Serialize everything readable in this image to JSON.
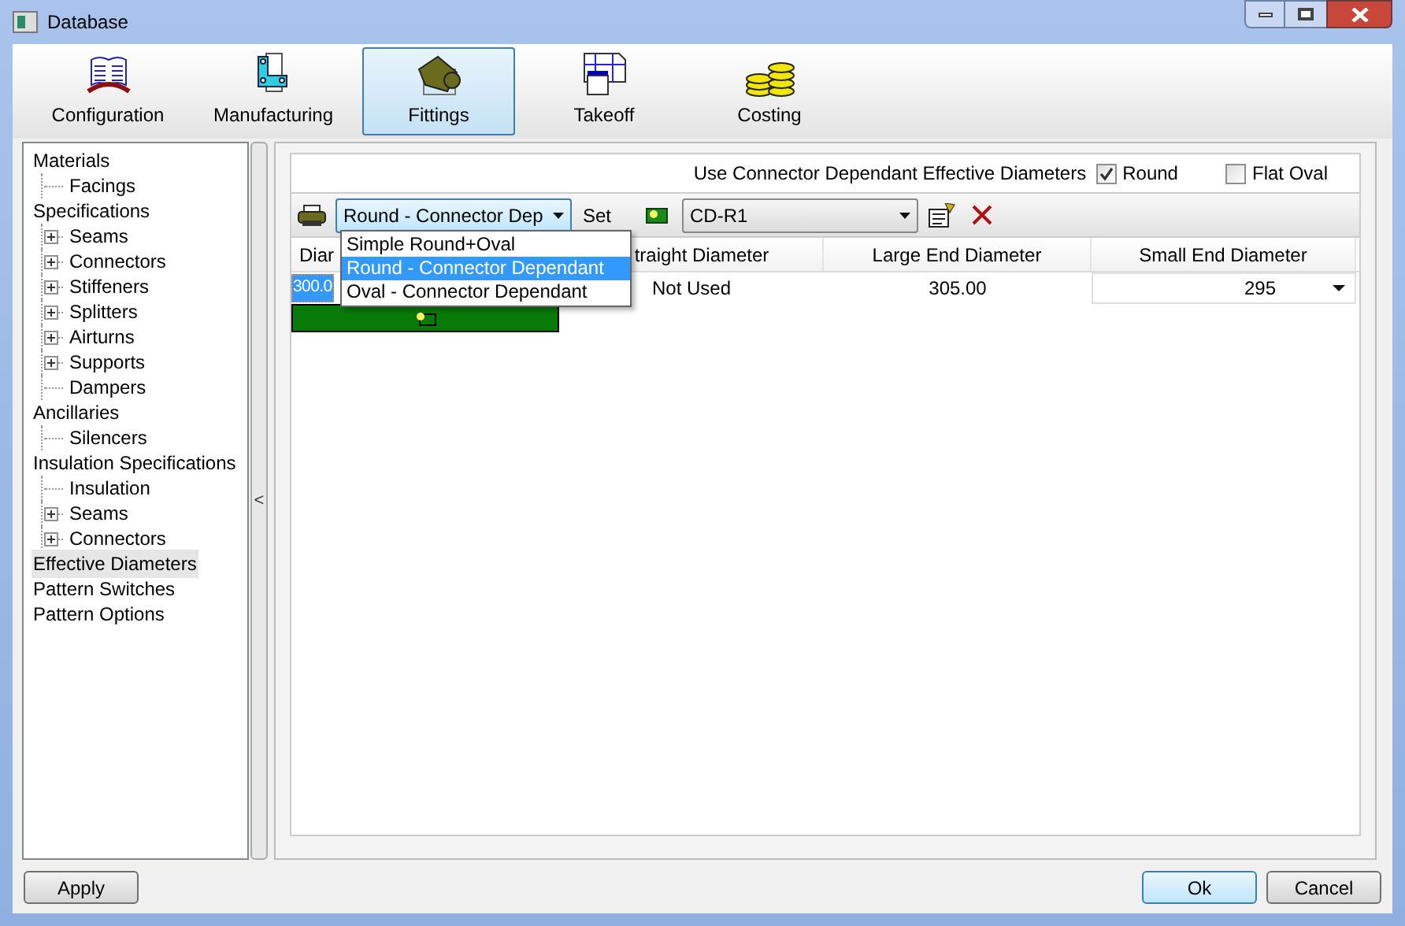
{
  "window": {
    "title": "Database"
  },
  "tabs": [
    {
      "label": "Configuration",
      "kind": "book",
      "selected": false
    },
    {
      "label": "Manufacturing",
      "kind": "bracket",
      "selected": false
    },
    {
      "label": "Fittings",
      "kind": "fitting",
      "selected": true
    },
    {
      "label": "Takeoff",
      "kind": "sheet",
      "selected": false
    },
    {
      "label": "Costing",
      "kind": "coins",
      "selected": false
    }
  ],
  "tree": [
    {
      "label": "Materials",
      "selected": false,
      "children": [
        {
          "label": "Facings",
          "selected": false
        }
      ]
    },
    {
      "label": "Specifications",
      "selected": false,
      "children": [
        {
          "label": "Seams",
          "expanded": false,
          "selected": false
        },
        {
          "label": "Connectors",
          "expanded": false,
          "selected": false
        },
        {
          "label": "Stiffeners",
          "expanded": false,
          "selected": false
        },
        {
          "label": "Splitters",
          "expanded": false,
          "selected": false
        },
        {
          "label": "Airturns",
          "expanded": false,
          "selected": false
        },
        {
          "label": "Supports",
          "expanded": false,
          "selected": false
        },
        {
          "label": "Dampers",
          "selected": false
        }
      ]
    },
    {
      "label": "Ancillaries",
      "selected": false,
      "children": [
        {
          "label": "Silencers",
          "selected": false
        }
      ]
    },
    {
      "label": "Insulation Specifications",
      "selected": false,
      "children": [
        {
          "label": "Insulation",
          "selected": false
        },
        {
          "label": "Seams",
          "expanded": false,
          "selected": false
        },
        {
          "label": "Connectors",
          "expanded": false,
          "selected": false
        }
      ]
    },
    {
      "label": "Effective Diameters",
      "selected": true
    },
    {
      "label": "Pattern Switches",
      "selected": false
    },
    {
      "label": "Pattern Options",
      "selected": false
    }
  ],
  "splitter": {
    "label": "<"
  },
  "options": {
    "label": "Use Connector Dependant Effective Diameters",
    "checkboxes": [
      {
        "label": "Round",
        "checked": true
      },
      {
        "label": "Flat Oval",
        "checked": false
      }
    ]
  },
  "toolbar": {
    "type_combo": {
      "value": "Round - Connector Dep",
      "options": [
        {
          "label": "Simple Round+Oval",
          "selected": false
        },
        {
          "label": "Round - Connector Dependant",
          "selected": true
        },
        {
          "label": "Oval - Connector Dependant",
          "selected": false
        }
      ]
    },
    "set_label": "Set",
    "set_combo": {
      "value": "CD-R1"
    }
  },
  "table": {
    "columns": [
      "Diar",
      "traight Diameter",
      "Large End Diameter",
      "Small End Diameter"
    ],
    "rows": [
      [
        "300.0",
        "Not Used",
        "305.00",
        "295"
      ]
    ]
  },
  "buttons": {
    "apply": "Apply",
    "ok": "Ok",
    "cancel": "Cancel"
  }
}
